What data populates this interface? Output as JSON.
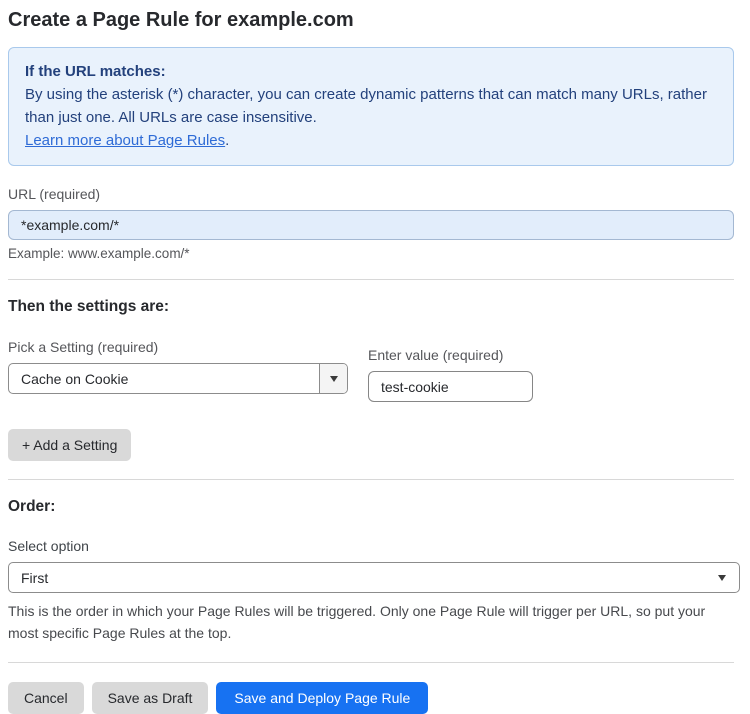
{
  "page": {
    "title": "Create a Page Rule for example.com"
  },
  "info_box": {
    "heading": "If the URL matches:",
    "body": "By using the asterisk (*) character, you can create dynamic patterns that can match many URLs, rather than just one. All URLs are case insensitive.",
    "link_label": "Learn more about Page Rules",
    "link_suffix": "."
  },
  "url_field": {
    "label": "URL (required)",
    "value": "*example.com/*",
    "example": "Example: www.example.com/*"
  },
  "settings_section": {
    "heading": "Then the settings are:",
    "setting_picker": {
      "label": "Pick a Setting (required)",
      "value": "Cache on Cookie"
    },
    "value_field": {
      "label": "Enter value (required)",
      "value": "test-cookie"
    },
    "add_setting_label": "+ Add a Setting"
  },
  "order_section": {
    "heading": "Order:",
    "select_label": "Select option",
    "selected_option": "First",
    "help_text": "This is the order in which your Page Rules will be triggered. Only one Page Rule will trigger per URL, so put your most specific Page Rules at the top."
  },
  "footer": {
    "cancel_label": "Cancel",
    "save_draft_label": "Save as Draft",
    "save_deploy_label": "Save and Deploy Page Rule"
  },
  "icons": {
    "dropdown_caret": "chevron-down-icon"
  },
  "colors": {
    "info_bg": "#e9f2fc",
    "info_border": "#a9c9ec",
    "info_text": "#23417c",
    "link": "#2e6bd6",
    "url_input_bg": "#e2edfb",
    "url_input_border": "#a4b8d2",
    "primary_button": "#1772f2",
    "secondary_button": "#d9d9d9",
    "text_dark": "#27292d",
    "label_gray": "#55565a",
    "control_border": "#8c8c8c",
    "divider": "#d8d8d8"
  }
}
